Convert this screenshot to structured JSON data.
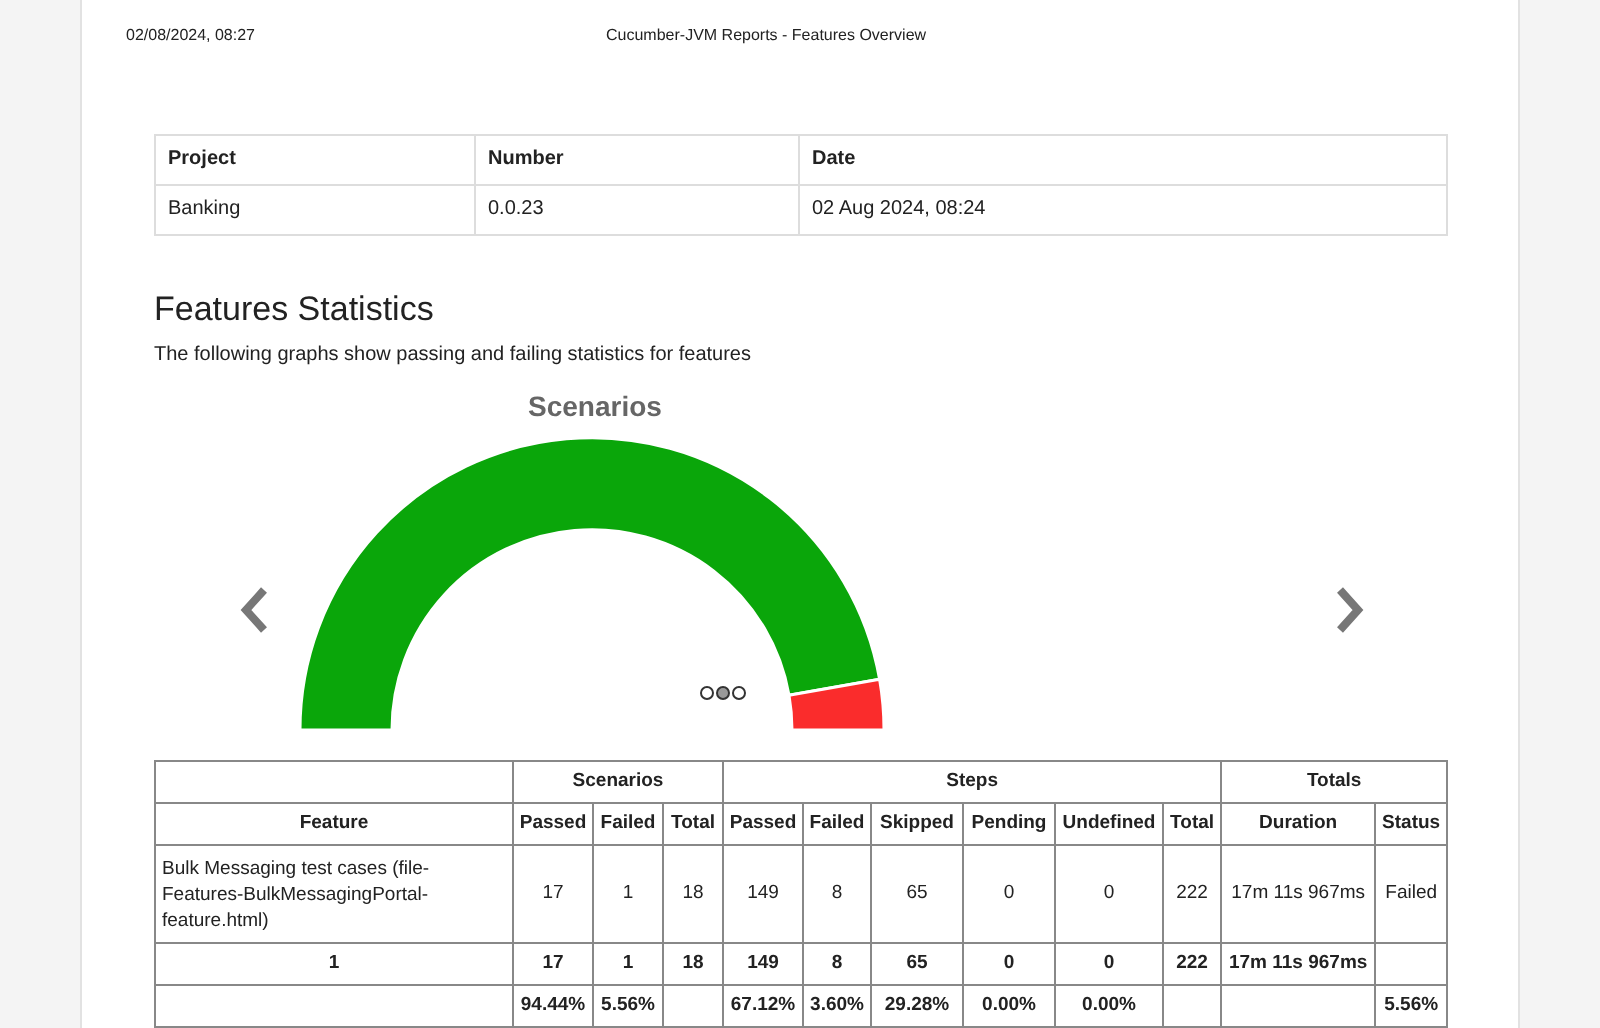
{
  "header": {
    "timestamp": "02/08/2024, 08:27",
    "title": "Cucumber-JVM Reports - Features Overview"
  },
  "info_table": {
    "columns": [
      "Project",
      "Number",
      "Date"
    ],
    "row": [
      "Banking",
      "0.0.23",
      "02 Aug 2024, 08:24"
    ]
  },
  "section": {
    "title": "Features Statistics",
    "description": "The following graphs show passing and failing statistics for features"
  },
  "carousel": {
    "title": "Scenarios",
    "dots": [
      {
        "selected": false
      },
      {
        "selected": true
      },
      {
        "selected": false
      }
    ]
  },
  "stats_table": {
    "groups": [
      {
        "label": "Scenarios"
      },
      {
        "label": "Steps"
      },
      {
        "label": "Totals"
      }
    ],
    "columns": [
      "Feature",
      "Passed",
      "Failed",
      "Total",
      "Passed",
      "Failed",
      "Skipped",
      "Pending",
      "Undefined",
      "Total",
      "Duration",
      "Status"
    ],
    "rows": [
      {
        "kind": "feature",
        "cells": [
          "Bulk Messaging test cases (file-Features-BulkMessagingPortal-feature.html)",
          "17",
          "1",
          "18",
          "149",
          "8",
          "65",
          "0",
          "0",
          "222",
          "17m 11s 967ms",
          "Failed"
        ]
      },
      {
        "kind": "total",
        "cells": [
          "1",
          "17",
          "1",
          "18",
          "149",
          "8",
          "65",
          "0",
          "0",
          "222",
          "17m 11s 967ms",
          ""
        ]
      },
      {
        "kind": "percent",
        "cells": [
          "",
          "94.44%",
          "5.56%",
          "",
          "67.12%",
          "3.60%",
          "29.28%",
          "0.00%",
          "0.00%",
          "",
          "",
          "5.56%"
        ]
      }
    ]
  }
}
